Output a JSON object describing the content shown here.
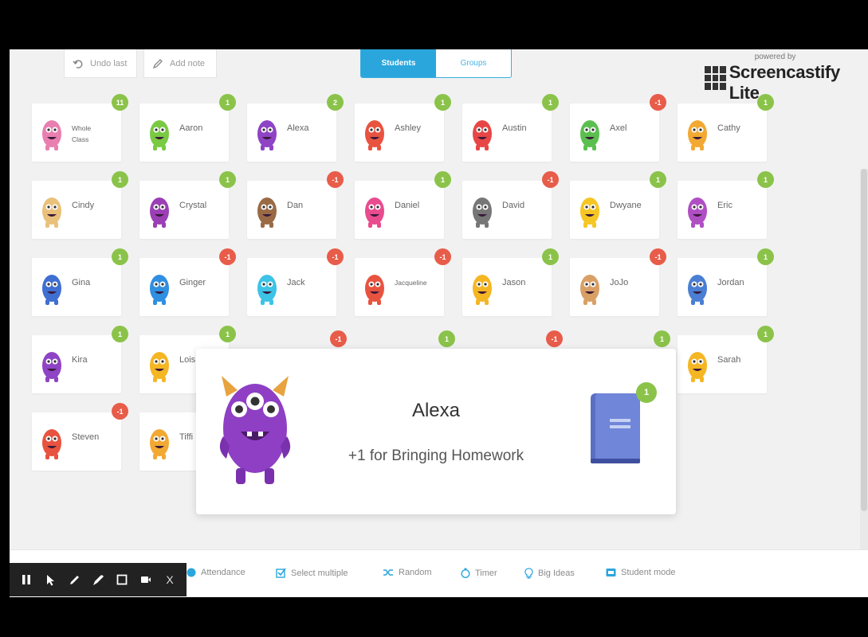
{
  "toolbar": {
    "undo_label": "Undo last",
    "add_note_label": "Add note",
    "tabs": [
      {
        "label": "Students",
        "active": true
      },
      {
        "label": "Groups",
        "active": false
      }
    ]
  },
  "branding": {
    "small_text": "powered by",
    "big_text": "Screencastify Lite"
  },
  "students": [
    {
      "name": "Whole\nClass",
      "points": "11",
      "positive": true,
      "color": "#e87fb0"
    },
    {
      "name": "Aaron",
      "points": "1",
      "positive": true,
      "color": "#7ac943"
    },
    {
      "name": "Alexa",
      "points": "2",
      "positive": true,
      "color": "#8e44c4"
    },
    {
      "name": "Ashley",
      "points": "1",
      "positive": true,
      "color": "#e8533f"
    },
    {
      "name": "Austin",
      "points": "1",
      "positive": true,
      "color": "#e84646"
    },
    {
      "name": "Axel",
      "points": "-1",
      "positive": false,
      "color": "#5bbf4f"
    },
    {
      "name": "Cathy",
      "points": "1",
      "positive": true,
      "color": "#f2a933"
    },
    {
      "name": "Cindy",
      "points": "1",
      "positive": true,
      "color": "#e9c17a"
    },
    {
      "name": "Crystal",
      "points": "1",
      "positive": true,
      "color": "#9b3fb5"
    },
    {
      "name": "Dan",
      "points": "-1",
      "positive": false,
      "color": "#9a6a45"
    },
    {
      "name": "Daniel",
      "points": "1",
      "positive": true,
      "color": "#e94b8f"
    },
    {
      "name": "David",
      "points": "-1",
      "positive": false,
      "color": "#777777"
    },
    {
      "name": "Dwyane",
      "points": "1",
      "positive": true,
      "color": "#f5c624"
    },
    {
      "name": "Eric",
      "points": "1",
      "positive": true,
      "color": "#b04fc4"
    },
    {
      "name": "Gina",
      "points": "1",
      "positive": true,
      "color": "#3f6fd1"
    },
    {
      "name": "Ginger",
      "points": "-1",
      "positive": false,
      "color": "#2f8fe0"
    },
    {
      "name": "Jack",
      "points": "-1",
      "positive": false,
      "color": "#3cc3e6"
    },
    {
      "name": "Jacqueline",
      "points": "-1",
      "positive": false,
      "color": "#e8533f"
    },
    {
      "name": "Jason",
      "points": "1",
      "positive": true,
      "color": "#f5b624"
    },
    {
      "name": "JoJo",
      "points": "-1",
      "positive": false,
      "color": "#d9a066"
    },
    {
      "name": "Jordan",
      "points": "1",
      "positive": true,
      "color": "#4a7fd4"
    },
    {
      "name": "Kira",
      "points": "1",
      "positive": true,
      "color": "#8e44c4"
    },
    {
      "name": "Lois",
      "points": "1",
      "positive": true,
      "color": "#f5b624"
    },
    {
      "name": "Sarah",
      "points": "1",
      "positive": true,
      "color": "#f5b624"
    },
    {
      "name": "Steven",
      "points": "-1",
      "positive": false,
      "color": "#e8533f"
    },
    {
      "name": "Tiffi",
      "points": "",
      "positive": true,
      "color": "#f2a933"
    }
  ],
  "hidden_badges": [
    "-1",
    "1",
    "-1",
    "1"
  ],
  "popup": {
    "student_name": "Alexa",
    "message": "+1 for Bringing Homework",
    "points": "1"
  },
  "bottom_bar": {
    "items": [
      {
        "label": "Attendance"
      },
      {
        "label": "Select multiple"
      },
      {
        "label": "Random"
      },
      {
        "label": "Timer"
      },
      {
        "label": "Big Ideas"
      },
      {
        "label": "Student mode"
      }
    ]
  },
  "recorder": {
    "buttons": [
      "pause-icon",
      "pointer-icon",
      "pen-icon",
      "marker-icon",
      "rectangle-icon",
      "camera-icon",
      "close-icon"
    ],
    "close_label": "X"
  }
}
